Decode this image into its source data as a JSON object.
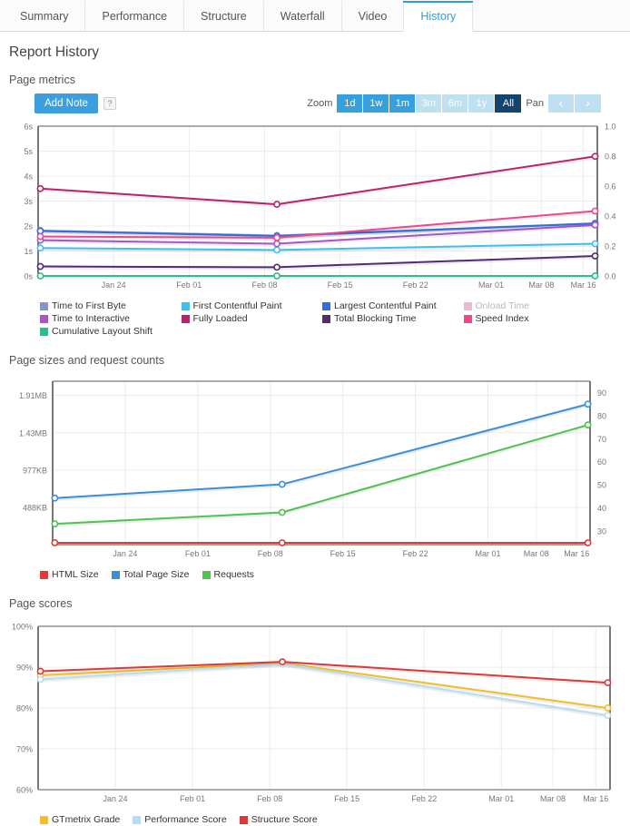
{
  "tabs": [
    {
      "label": "Summary",
      "active": false
    },
    {
      "label": "Performance",
      "active": false
    },
    {
      "label": "Structure",
      "active": false
    },
    {
      "label": "Waterfall",
      "active": false
    },
    {
      "label": "Video",
      "active": false
    },
    {
      "label": "History",
      "active": true
    }
  ],
  "page_title": "Report History",
  "sections": {
    "metrics_label": "Page metrics",
    "sizes_label": "Page sizes and request counts",
    "scores_label": "Page scores"
  },
  "toolbar": {
    "add_note_label": "Add Note",
    "help_label": "?",
    "zoom_label": "Zoom",
    "pan_label": "Pan",
    "ranges": [
      {
        "label": "1d",
        "state": "mid"
      },
      {
        "label": "1w",
        "state": "mid"
      },
      {
        "label": "1m",
        "state": "mid"
      },
      {
        "label": "3m",
        "state": "off"
      },
      {
        "label": "6m",
        "state": "off"
      },
      {
        "label": "1y",
        "state": "off"
      },
      {
        "label": "All",
        "state": "sel"
      }
    ],
    "pan_prev": "‹",
    "pan_next": "›"
  },
  "chart_data": [
    {
      "id": "page-metrics",
      "type": "line",
      "title": "Page metrics",
      "x": [
        "2024-01-19",
        "2024-02-09",
        "2024-03-21"
      ],
      "xtick_labels": [
        "Jan 24",
        "Feb 01",
        "Feb 08",
        "Feb 15",
        "Feb 22",
        "Mar 01",
        "Mar 08",
        "Mar 16"
      ],
      "xtick_pos": [
        0.135,
        0.27,
        0.405,
        0.54,
        0.675,
        0.81,
        0.9,
        0.975
      ],
      "ylabel": "",
      "ylim": [
        0,
        6
      ],
      "ytick_labels": [
        "0s",
        "1s",
        "2s",
        "3s",
        "4s",
        "5s",
        "6s"
      ],
      "yticks": [
        0,
        1,
        2,
        3,
        4,
        5,
        6
      ],
      "y2lim": [
        0.0,
        1.0
      ],
      "y2tick_labels": [
        "0.0",
        "0.2",
        "0.4",
        "0.6",
        "0.8",
        "1.0"
      ],
      "y2ticks": [
        0.0,
        0.2,
        0.4,
        0.6,
        0.8,
        1.0
      ],
      "grid": true,
      "legend_position": "bottom",
      "series": [
        {
          "name": "Time to First Byte",
          "color": "#8495c8",
          "axis": "left",
          "values": [
            1.82,
            1.62,
            2.11
          ],
          "disabled": false
        },
        {
          "name": "First Contentful Paint",
          "color": "#3ec0f0",
          "axis": "left",
          "values": [
            1.12,
            1.04,
            1.29
          ],
          "disabled": false
        },
        {
          "name": "Largest Contentful Paint",
          "color": "#2f6ee0",
          "axis": "left",
          "values": [
            1.8,
            1.6,
            2.1
          ],
          "disabled": false
        },
        {
          "name": "Onload Time",
          "color": "#e8b2c8",
          "axis": "left",
          "values": null,
          "disabled": true
        },
        {
          "name": "Time to Interactive",
          "color": "#a855c8",
          "axis": "left",
          "values": [
            1.43,
            1.29,
            2.04
          ],
          "disabled": false
        },
        {
          "name": "Fully Loaded",
          "color": "#b8246b",
          "axis": "left",
          "values": [
            3.5,
            2.87,
            4.79
          ],
          "disabled": false
        },
        {
          "name": "Total Blocking Time",
          "color": "#512c72",
          "axis": "left",
          "values": [
            0.38,
            0.35,
            0.8
          ],
          "disabled": false
        },
        {
          "name": "Speed Index",
          "color": "#f0488f",
          "axis": "left",
          "values": [
            1.58,
            1.53,
            2.6
          ],
          "disabled": false
        },
        {
          "name": "Cumulative Layout Shift",
          "color": "#2bbd8c",
          "axis": "right",
          "values": [
            0.0,
            0.0,
            0.0
          ],
          "disabled": false
        }
      ]
    },
    {
      "id": "page-sizes",
      "type": "line",
      "title": "Page sizes and request counts",
      "x": [
        "2024-01-19",
        "2024-02-09",
        "2024-03-21"
      ],
      "xtick_labels": [
        "Jan 24",
        "Feb 01",
        "Feb 08",
        "Feb 15",
        "Feb 22",
        "Mar 01",
        "Mar 08",
        "Mar 16"
      ],
      "xtick_pos": [
        0.135,
        0.27,
        0.405,
        0.54,
        0.675,
        0.81,
        0.9,
        0.975
      ],
      "ylim": [
        0,
        2140
      ],
      "ytick_labels": [
        "488KB",
        "977KB",
        "1.43MB",
        "1.91MB"
      ],
      "yticks": [
        488,
        977,
        1464,
        1955
      ],
      "y2lim": [
        24,
        95
      ],
      "y2tick_labels": [
        "30",
        "40",
        "50",
        "60",
        "70",
        "80",
        "90"
      ],
      "y2ticks": [
        30,
        40,
        50,
        60,
        70,
        80,
        90
      ],
      "grid": true,
      "legend_position": "bottom",
      "series": [
        {
          "name": "HTML Size",
          "color": "#e03a3a",
          "axis": "left",
          "values": [
            24,
            24,
            24
          ]
        },
        {
          "name": "Total Page Size",
          "color": "#3a8fdb",
          "axis": "left",
          "values": [
            610,
            790,
            1840
          ]
        },
        {
          "name": "Requests",
          "color": "#4fc24f",
          "axis": "right",
          "values": [
            33,
            38,
            76
          ]
        }
      ]
    },
    {
      "id": "page-scores",
      "type": "line",
      "title": "Page scores",
      "x": [
        "2024-01-19",
        "2024-02-09",
        "2024-03-21"
      ],
      "xtick_labels": [
        "Jan 24",
        "Feb 01",
        "Feb 08",
        "Feb 15",
        "Feb 22",
        "Mar 01",
        "Mar 08",
        "Mar 16"
      ],
      "xtick_pos": [
        0.135,
        0.27,
        0.405,
        0.54,
        0.675,
        0.81,
        0.9,
        0.975
      ],
      "ylim": [
        60,
        100
      ],
      "ytick_labels": [
        "60%",
        "70%",
        "80%",
        "90%",
        "100%"
      ],
      "yticks": [
        60,
        70,
        80,
        90,
        100
      ],
      "grid": true,
      "legend_position": "bottom",
      "series": [
        {
          "name": "GTmetrix Grade",
          "color": "#f2bc2b",
          "axis": "left",
          "values": [
            88.0,
            91.0,
            80.0
          ]
        },
        {
          "name": "Performance Score",
          "color": "#b8dcf2",
          "axis": "left",
          "values": [
            87.0,
            90.8,
            78.2
          ]
        },
        {
          "name": "Structure Score",
          "color": "#dc3a3a",
          "axis": "left",
          "values": [
            89.0,
            91.3,
            86.2
          ]
        }
      ]
    }
  ]
}
